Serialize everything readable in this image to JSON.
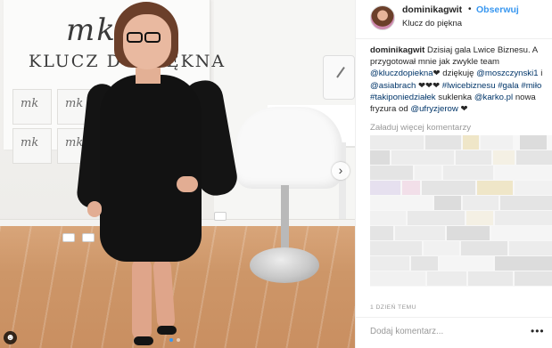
{
  "post": {
    "username": "dominikagwit",
    "separator": "•",
    "follow_label": "Obserwuj",
    "location": "Klucz do piękna"
  },
  "photo": {
    "banner_script": "mk",
    "banner_text": "KLUCZ DO PIĘKNA",
    "tile_logo": "mk",
    "next_icon": "chevron-right",
    "slide_count": 2,
    "active_slide": 1
  },
  "caption": {
    "username": "dominikagwit",
    "parts": [
      " Dzisiaj gala Lwice Biznesu. A przygotował mnie jak zwykle team ",
      "@kluczdopiekna",
      "❤ dziękuję ",
      "@moszczynski1",
      " i ",
      "@asiabrach",
      " ❤❤❤ ",
      "#lwicebiznesu",
      " ",
      "#gala",
      " ",
      "#miło",
      " ",
      "#takiponiedziałek",
      " suklenka ",
      "@karko.pl",
      " nowa fryzura od ",
      "@ufryzjerow",
      " ❤"
    ]
  },
  "comments": {
    "load_more": "Załaduj więcej komentarzy"
  },
  "meta": {
    "timestamp": "1 DZIEŃ TEMU"
  },
  "composer": {
    "placeholder": "Dodaj komentarz...",
    "more_icon": "ellipsis"
  },
  "colors": {
    "link_blue": "#3897f0",
    "mention_dark": "#003569",
    "muted": "#999999"
  }
}
